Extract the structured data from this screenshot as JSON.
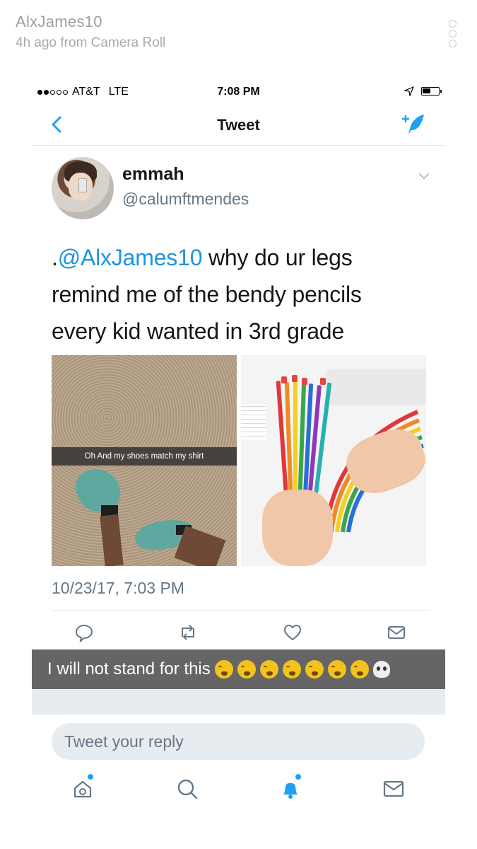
{
  "story": {
    "username": "AlxJames10",
    "subtitle": "4h ago from Camera Roll"
  },
  "status_bar": {
    "carrier": "AT&T",
    "network": "LTE",
    "time": "7:08 PM"
  },
  "nav": {
    "title": "Tweet"
  },
  "tweet": {
    "display_name": "emmah",
    "handle": "@calumftmendes",
    "text_prefix": ".",
    "mention": "@AlxJames10",
    "text_body": " why do ur legs remind me of the bendy pencils every kid wanted in 3rd grade",
    "image1_caption": "Oh And my shoes match my shirt",
    "timestamp": "10/23/17, 7:03 PM"
  },
  "caption": {
    "text": "I will not stand for this",
    "emojis": [
      "weary-face",
      "weary-face",
      "weary-face",
      "weary-face",
      "weary-face",
      "weary-face",
      "weary-face",
      "skull"
    ]
  },
  "reply": {
    "placeholder": "Tweet your reply"
  },
  "colors": {
    "accent": "#1DA1F2",
    "mention": "#1B95E0",
    "secondary_text": "#657786"
  }
}
